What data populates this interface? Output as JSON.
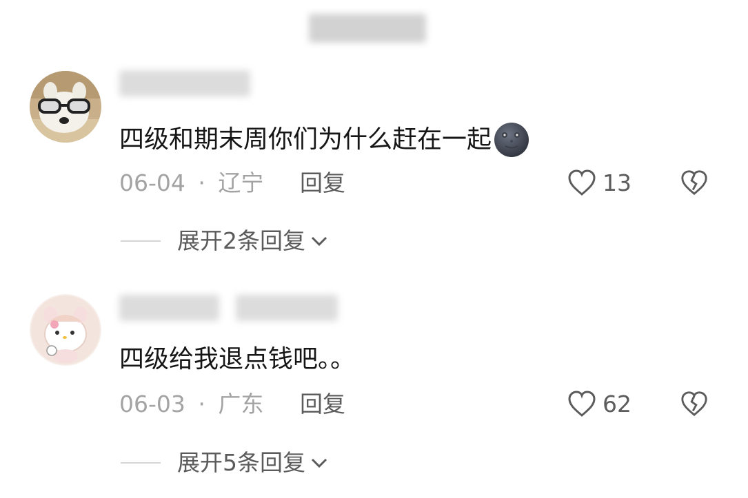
{
  "comments": [
    {
      "text": "四级和期末周你们为什么赶在一起",
      "emoji_icon": "new-moon-face-icon",
      "date": "06-04",
      "separator": "·",
      "location": "辽宁",
      "reply_label": "回复",
      "likes": "13",
      "expand_label": "展开2条回复"
    },
    {
      "text": "四级给我退点钱吧。。",
      "date": "06-03",
      "separator": "·",
      "location": "广东",
      "reply_label": "回复",
      "likes": "62",
      "expand_label": "展开5条回复"
    }
  ],
  "colors": {
    "text_primary": "#161616",
    "text_meta": "#a3a3a3",
    "text_secondary": "#5b5b5b",
    "divider": "#d4d4d4"
  }
}
